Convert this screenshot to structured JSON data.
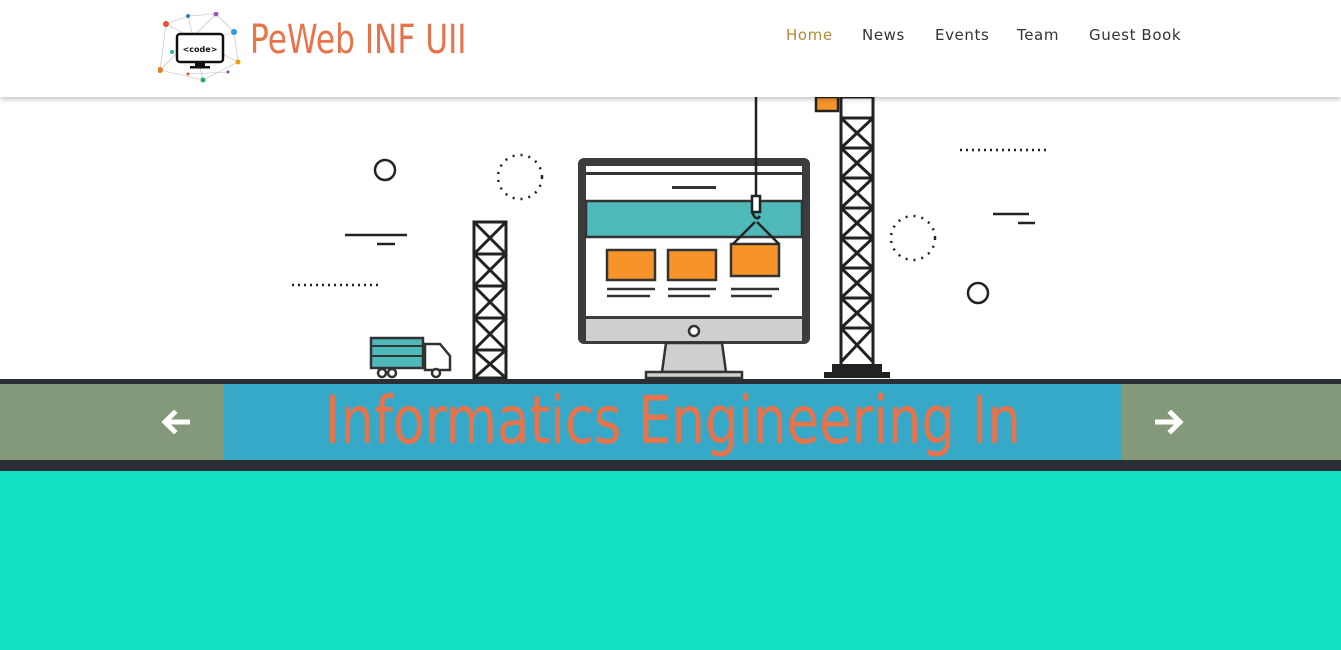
{
  "brand": {
    "name": "PeWeb INF UII",
    "logo_text": "<code>"
  },
  "nav": {
    "items": [
      "Home",
      "News",
      "Events",
      "Team",
      "Guest Book"
    ],
    "active": "Home"
  },
  "hero": {
    "caption": "Informatics Engineering In"
  },
  "colors": {
    "brand": "#e8734a",
    "nav_active": "#b48a3c",
    "band": "#36a8c8",
    "control": "#84987a",
    "page_bg": "#14e0c5",
    "screen_bar": "#4fb8b9",
    "box_orange": "#f6942a"
  },
  "icons": {
    "prev": "arrow-left-icon",
    "next": "arrow-right-icon"
  }
}
